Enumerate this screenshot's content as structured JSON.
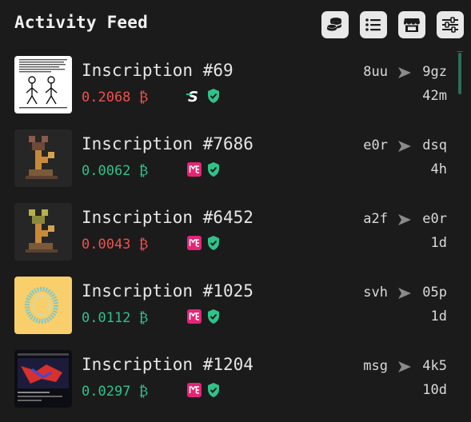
{
  "header": {
    "title": "Activity Feed",
    "buttons": [
      {
        "icon": "coins-icon"
      },
      {
        "icon": "list-icon"
      },
      {
        "icon": "store-icon"
      },
      {
        "icon": "sliders-icon"
      }
    ]
  },
  "feed": {
    "items": [
      {
        "name": "Inscription #69",
        "price": "0.2068 ₿",
        "price_color": "#f0504f",
        "marketplace_icon": "s-marketplace-icon",
        "verified_icon": "shield-check-icon",
        "from": "8uu",
        "to": "9gz",
        "time": "42m"
      },
      {
        "name": "Inscription #7686",
        "price": "0.0062 ₿",
        "price_color": "#2fc28a",
        "marketplace_icon": "magic-eden-icon",
        "verified_icon": "shield-check-icon",
        "from": "e0r",
        "to": "dsq",
        "time": "4h"
      },
      {
        "name": "Inscription #6452",
        "price": "0.0043 ₿",
        "price_color": "#f0504f",
        "marketplace_icon": "magic-eden-icon",
        "verified_icon": "shield-check-icon",
        "from": "a2f",
        "to": "e0r",
        "time": "1d"
      },
      {
        "name": "Inscription #1025",
        "price": "0.0112 ₿",
        "price_color": "#2fc28a",
        "marketplace_icon": "magic-eden-icon",
        "verified_icon": "shield-check-icon",
        "from": "svh",
        "to": "05p",
        "time": "1d"
      },
      {
        "name": "Inscription #1204",
        "price": "0.0297 ₿",
        "price_color": "#2fc28a",
        "marketplace_icon": "magic-eden-icon",
        "verified_icon": "shield-check-icon",
        "from": "msg",
        "to": "4k5",
        "time": "10d"
      }
    ]
  },
  "colors": {
    "background": "#1b1b1b",
    "price_up": "#2fc28a",
    "price_down": "#f0504f",
    "accent": "#2f6b58",
    "magic_eden": "#e42575"
  }
}
